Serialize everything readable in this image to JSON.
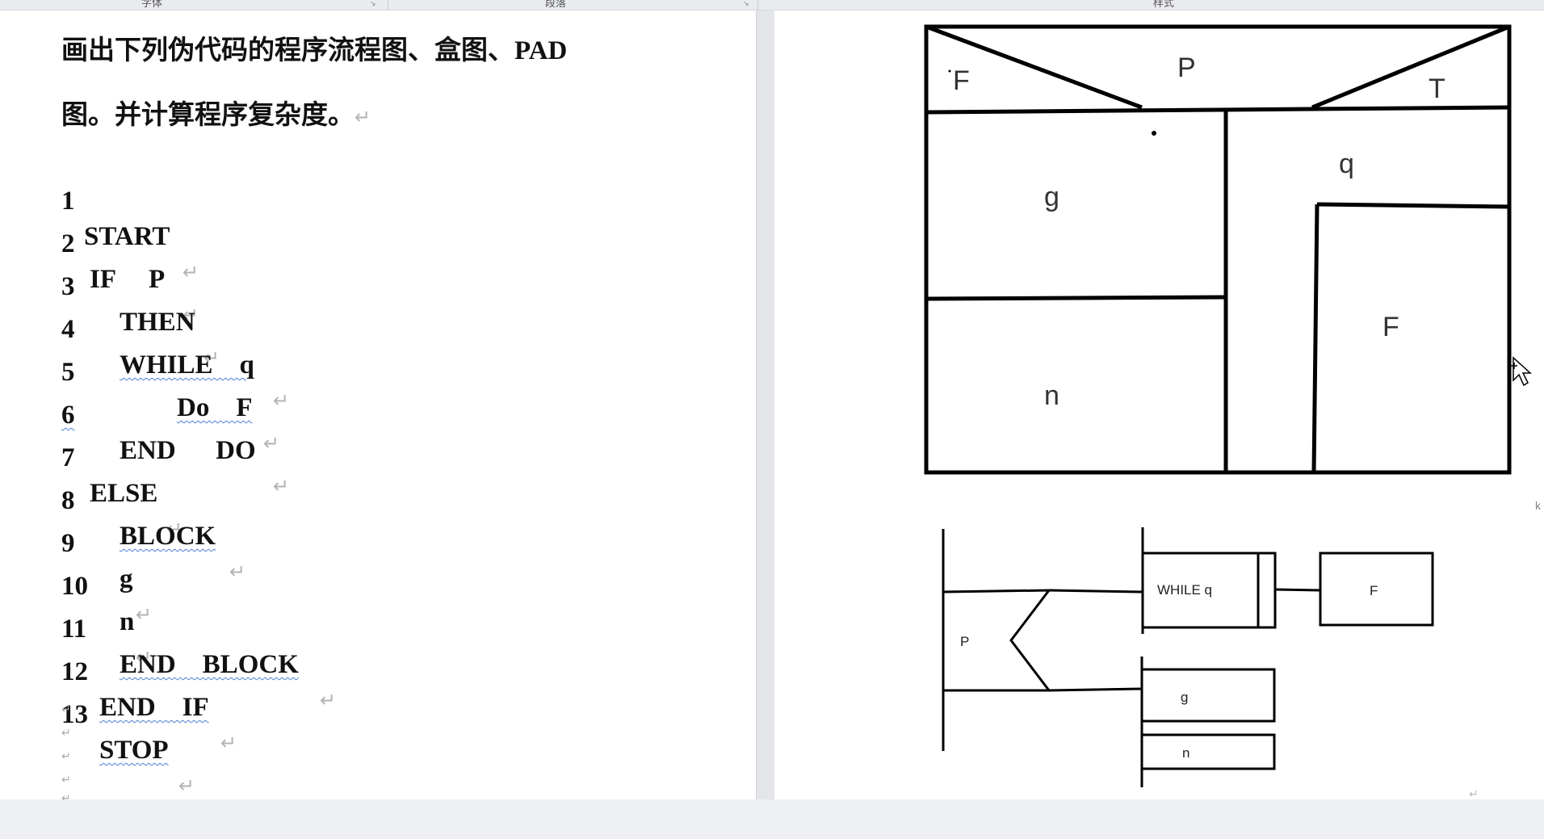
{
  "ribbon": {
    "groups": [
      "字体",
      "段落",
      "样式"
    ]
  },
  "document": {
    "title_line1_cn": "画出下列伪代码的程序流程图、盒图、",
    "title_line1_latin": "PAD",
    "title_line2": "图。并计算程序复杂度。",
    "return_mark": "↵",
    "code": [
      {
        "num": "1",
        "text": "START"
      },
      {
        "num": "2",
        "text": "IF     P"
      },
      {
        "num": "3",
        "text": "THEN"
      },
      {
        "num": "4",
        "text": "WHILE    q"
      },
      {
        "num": "5",
        "text": "Do    F"
      },
      {
        "num": "6",
        "text": "END      DO"
      },
      {
        "num": "7",
        "text": "ELSE"
      },
      {
        "num": "8",
        "text": "BLOCK"
      },
      {
        "num": "9",
        "text": "g"
      },
      {
        "num": "10",
        "text": "n"
      },
      {
        "num": "11",
        "text": "END    BLOCK"
      },
      {
        "num": "12",
        "text": "END    IF"
      },
      {
        "num": "13",
        "text": "STOP"
      }
    ]
  },
  "box_diagram": {
    "cond_label": "P",
    "false_label": "F",
    "true_label": "T",
    "g_label": "g",
    "n_label": "n",
    "while_label": "q",
    "body_label": "F"
  },
  "pad_diagram": {
    "p_label": "P",
    "while_label": "WHILE q",
    "f_label": "F",
    "g_label": "g",
    "n_label": "n"
  }
}
